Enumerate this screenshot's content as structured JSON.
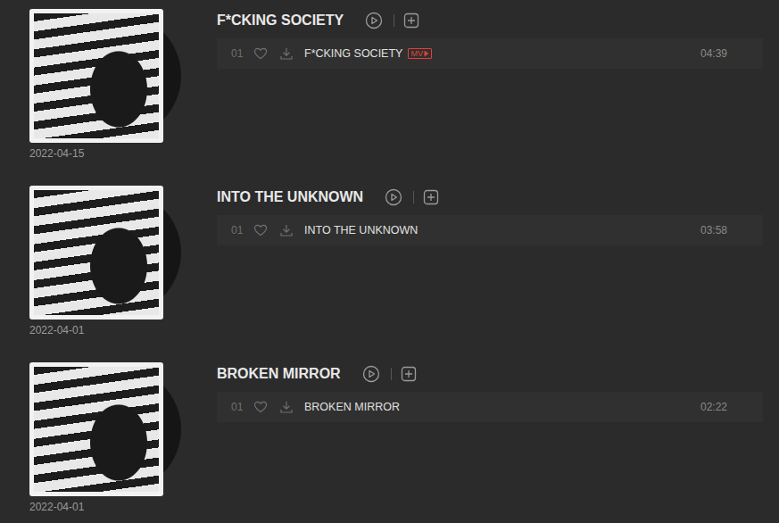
{
  "albums": [
    {
      "title": "F*CKING SOCIETY",
      "date": "2022-04-15",
      "tracks": [
        {
          "number": "01",
          "title": "F*CKING SOCIETY",
          "badge": "MV",
          "duration": "04:39"
        }
      ]
    },
    {
      "title": "INTO THE UNKNOWN",
      "date": "2022-04-01",
      "tracks": [
        {
          "number": "01",
          "title": "INTO THE UNKNOWN",
          "badge": null,
          "duration": "03:58"
        }
      ]
    },
    {
      "title": "BROKEN MIRROR",
      "date": "2022-04-01",
      "tracks": [
        {
          "number": "01",
          "title": "BROKEN MIRROR",
          "badge": null,
          "duration": "02:22"
        }
      ]
    }
  ]
}
